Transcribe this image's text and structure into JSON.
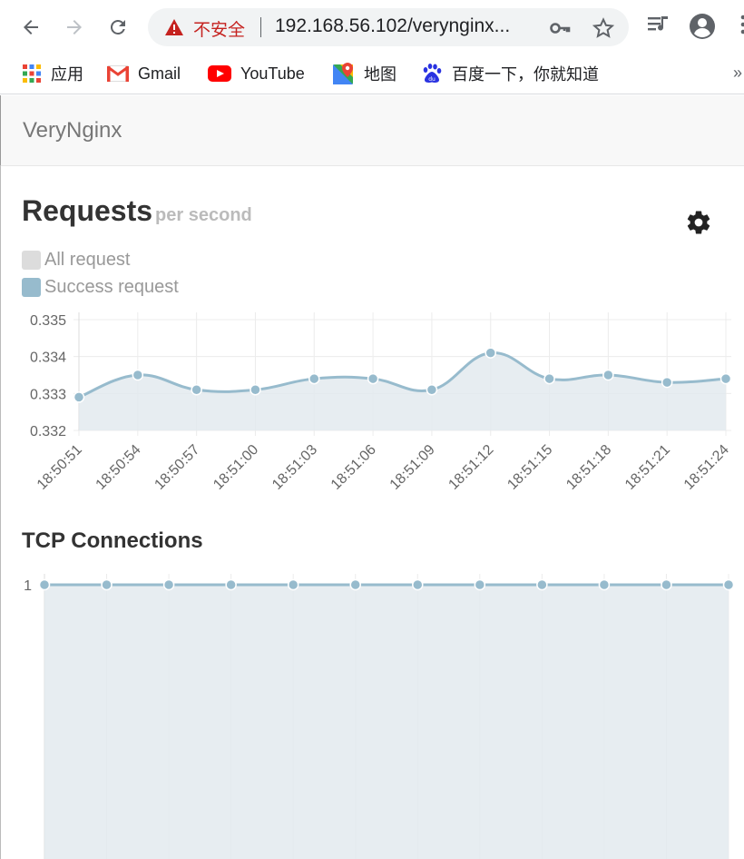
{
  "browser": {
    "insecure_label": "不安全",
    "url": "192.168.56.102/verynginx...",
    "bookmarks": [
      {
        "label": "应用",
        "icon": "apps-grid-icon"
      },
      {
        "label": "Gmail",
        "icon": "gmail-icon"
      },
      {
        "label": "YouTube",
        "icon": "youtube-icon"
      },
      {
        "label": "地图",
        "icon": "maps-icon"
      },
      {
        "label": "百度一下，你就知道",
        "icon": "baidu-icon"
      }
    ],
    "more_label": "»"
  },
  "navbar": {
    "brand": "VeryNginx"
  },
  "requests": {
    "title": "Requests",
    "subtitle": "per second",
    "legend": [
      {
        "label": "All request",
        "color": "#dcdcdc"
      },
      {
        "label": "Success request",
        "color": "#97bbcd"
      }
    ]
  },
  "tcp": {
    "title": "TCP Connections"
  },
  "colors": {
    "series": "#97bbcd",
    "fill": "#e3eaee",
    "grid": "#ececec"
  },
  "chart_data": [
    {
      "type": "line",
      "title": "Requests per second",
      "categories": [
        "18:50:51",
        "18:50:54",
        "18:50:57",
        "18:51:00",
        "18:51:03",
        "18:51:06",
        "18:51:09",
        "18:51:12",
        "18:51:15",
        "18:51:18",
        "18:51:21",
        "18:51:24"
      ],
      "series": [
        {
          "name": "Success request",
          "values": [
            0.3329,
            0.3335,
            0.3331,
            0.3331,
            0.3334,
            0.3334,
            0.3331,
            0.3341,
            0.3334,
            0.3335,
            0.3333,
            0.3334
          ]
        }
      ],
      "yticks": [
        "0.335",
        "0.334",
        "0.333",
        "0.332"
      ],
      "ylim": [
        0.332,
        0.335
      ],
      "grid": true
    },
    {
      "type": "line",
      "title": "TCP Connections",
      "categories": [
        "",
        "",
        "",
        "",
        "",
        "",
        "",
        "",
        "",
        "",
        "",
        ""
      ],
      "series": [
        {
          "values": [
            1,
            1,
            1,
            1,
            1,
            1,
            1,
            1,
            1,
            1,
            1,
            1
          ]
        }
      ],
      "yticks": [
        "1"
      ],
      "ylim": [
        0,
        1
      ],
      "grid": true
    }
  ]
}
